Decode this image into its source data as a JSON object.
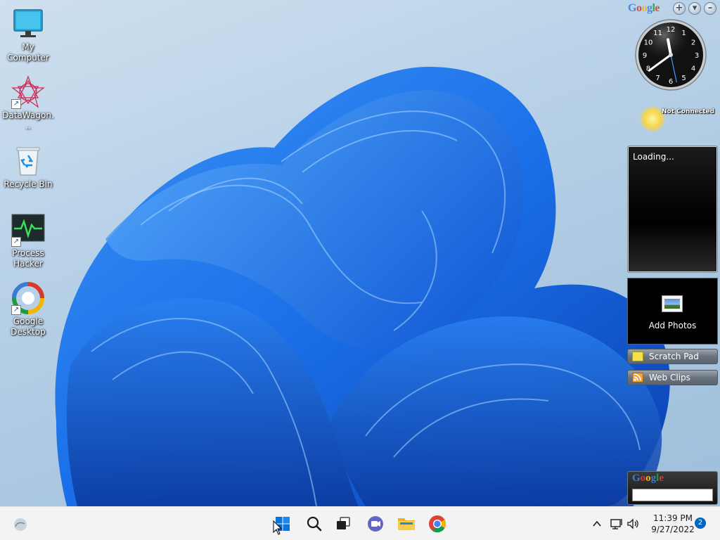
{
  "desktop_icons": [
    {
      "label": "My Computer",
      "icon": "monitor-icon",
      "shortcut": false
    },
    {
      "label": "DataWagon...",
      "icon": "datawagon-icon",
      "shortcut": true
    },
    {
      "label": "Recycle Bin",
      "icon": "recycle-bin-icon",
      "shortcut": false
    },
    {
      "label": "Process Hacker",
      "icon": "process-hacker-icon",
      "shortcut": true
    },
    {
      "label": "Google Desktop",
      "icon": "google-desktop-icon",
      "shortcut": true
    }
  ],
  "gadgets": {
    "header_brand": "Google",
    "add_button": "+",
    "options_button": "▾",
    "minimize_button": "–",
    "clock": {
      "hour": 11,
      "minute": 39,
      "second": 28,
      "numbers": [
        "12",
        "1",
        "2",
        "3",
        "4",
        "5",
        "6",
        "7",
        "8",
        "9",
        "10",
        "11"
      ]
    },
    "weather": {
      "status": "Not Connected"
    },
    "news_feed": {
      "status": "Loading..."
    },
    "photos": {
      "label": "Add Photos"
    },
    "scratch_pad": {
      "label": "Scratch Pad"
    },
    "web_clips": {
      "label": "Web Clips"
    },
    "search": {
      "brand": "Google",
      "value": ""
    }
  },
  "taskbar": {
    "apps": [
      {
        "name": "start",
        "icon": "windows-start-icon"
      },
      {
        "name": "search",
        "icon": "search-icon"
      },
      {
        "name": "task-view",
        "icon": "task-view-icon"
      },
      {
        "name": "teams-chat",
        "icon": "chat-icon"
      },
      {
        "name": "file-explorer",
        "icon": "folder-icon"
      },
      {
        "name": "chrome",
        "icon": "chrome-icon"
      }
    ],
    "tray": {
      "time": "11:39 PM",
      "date": "9/27/2022",
      "notification_count": "2"
    }
  },
  "colors": {
    "google": [
      "#3a7bd5",
      "#d63a2a",
      "#f4b400",
      "#3a7bd5",
      "#1e9c3a",
      "#d63a2a"
    ],
    "wallpaper_blue": "#1f6fe0",
    "taskbar_bg": "#f3f3f3"
  }
}
